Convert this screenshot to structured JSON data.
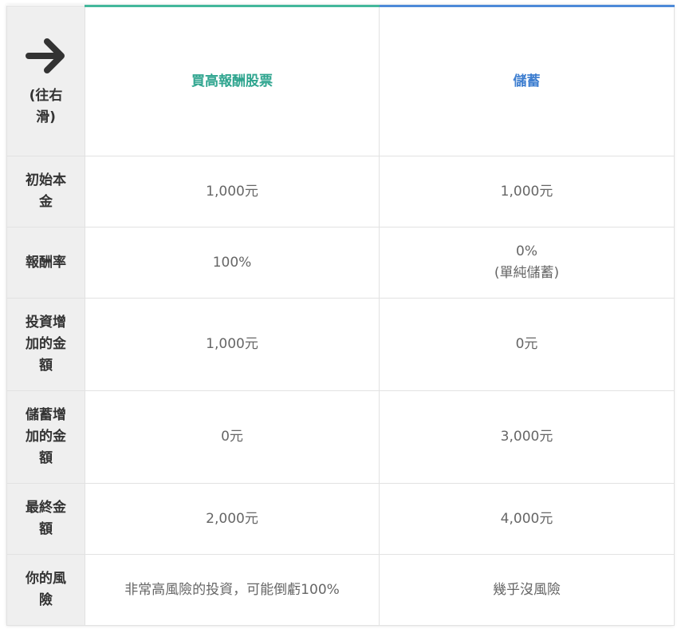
{
  "header": {
    "hint": "(往右滑)",
    "col1": "買高報酬股票",
    "col2": "儲蓄",
    "col1_color": "#2fa58f",
    "col2_color": "#3f7fd0",
    "icon": "arrow-right-icon"
  },
  "rows": [
    {
      "label": "初始本金",
      "col1": "1,000元",
      "col2": "1,000元"
    },
    {
      "label": "報酬率",
      "col1": "100%",
      "col2": "0%",
      "col2_note": "(單純儲蓄)"
    },
    {
      "label": "投資增加的金額",
      "col1": "1,000元",
      "col2": "0元"
    },
    {
      "label": "儲蓄增加的金額",
      "col1": "0元",
      "col2": "3,000元"
    },
    {
      "label": "最終金額",
      "col1": "2,000元",
      "col2": "4,000元"
    },
    {
      "label": "你的風險",
      "col1": "非常高風險的投資，可能倒虧100%",
      "col2": "幾乎沒風險"
    }
  ]
}
